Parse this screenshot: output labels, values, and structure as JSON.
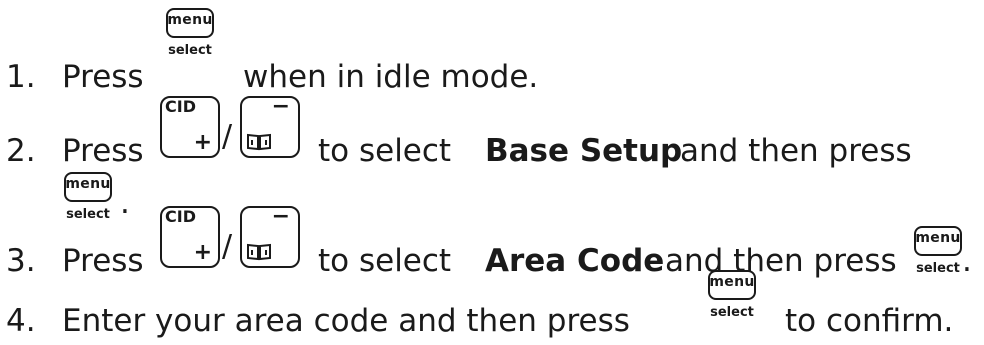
{
  "steps": [
    {
      "number": "1.",
      "parts": {
        "press": "Press",
        "rest": "when in idle mode."
      }
    },
    {
      "number": "2.",
      "parts": {
        "press": "Press",
        "mid": "to select",
        "bold": "Base Setup",
        "rest": "and then press",
        "end": "."
      }
    },
    {
      "number": "3.",
      "parts": {
        "press": "Press",
        "mid": "to select",
        "bold": "Area Code",
        "rest": "and then press",
        "end": "."
      }
    },
    {
      "number": "4.",
      "parts": {
        "text": "Enter your area code and then press",
        "rest": "to confirm."
      }
    }
  ],
  "keys": {
    "menu_select": {
      "top": "menu",
      "bottom": "select",
      "icon": "menu-select-key-icon"
    },
    "nav_up": {
      "label": "CID",
      "symbol": "+",
      "icon": "cid-up-key-icon"
    },
    "nav_down": {
      "symbol": "−",
      "icon": "phonebook-down-key-icon"
    },
    "separator": "/"
  }
}
